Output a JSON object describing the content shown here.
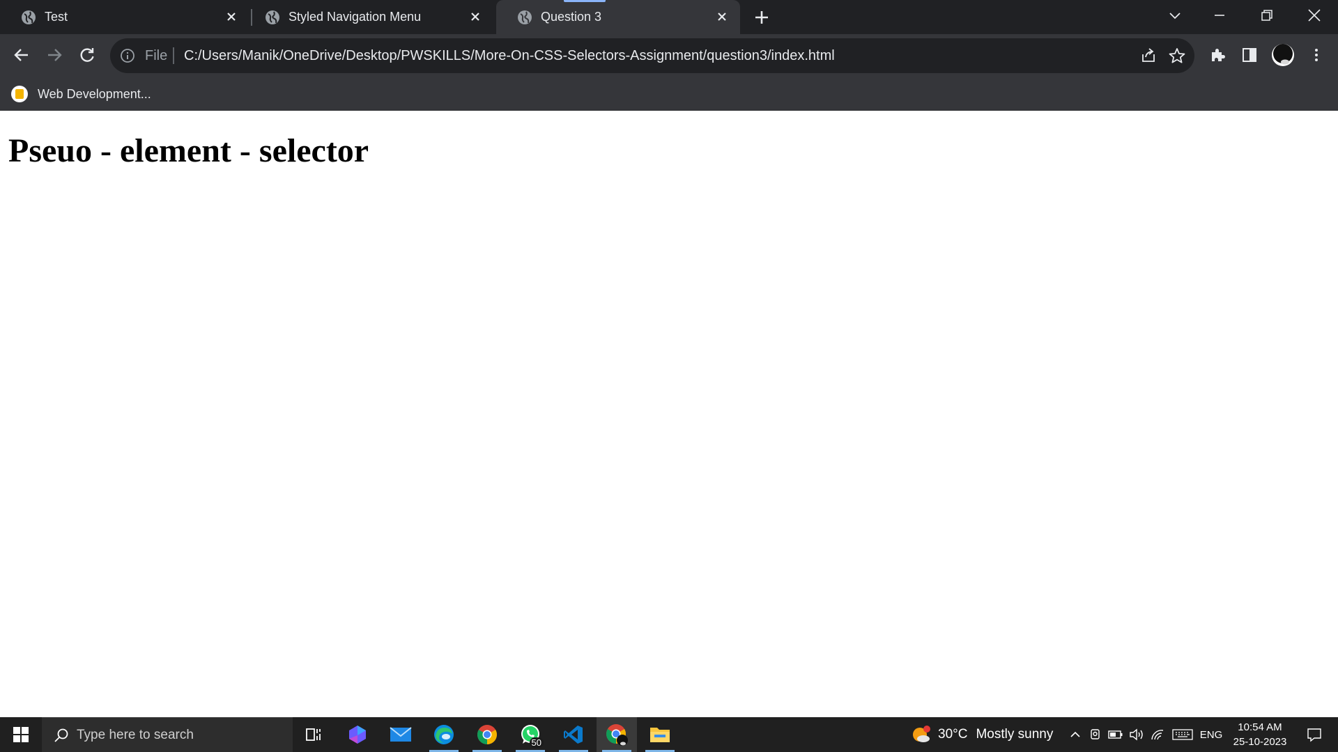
{
  "tabs": [
    {
      "title": "Test",
      "active": false,
      "icon": "globe-icon"
    },
    {
      "title": "Styled Navigation Menu",
      "active": false,
      "icon": "globe-icon"
    },
    {
      "title": "Question 3",
      "active": true,
      "icon": "globe-icon"
    }
  ],
  "omnibox": {
    "scheme_label": "File",
    "url": "C:/Users/Manik/OneDrive/Desktop/PWSKILLS/More-On-CSS-Selectors-Assignment/question3/index.html"
  },
  "bookmarks": [
    {
      "label": "Web Development..."
    }
  ],
  "page": {
    "heading": "Pseuo - element - selector"
  },
  "taskbar": {
    "search_placeholder": "Type here to search",
    "apps": [
      {
        "name": "task-view",
        "running": false
      },
      {
        "name": "copilot",
        "running": false
      },
      {
        "name": "mail",
        "running": false
      },
      {
        "name": "edge",
        "running": true
      },
      {
        "name": "chrome",
        "running": true
      },
      {
        "name": "whatsapp",
        "running": true,
        "badge": "50"
      },
      {
        "name": "vscode",
        "running": true
      },
      {
        "name": "chrome-profile",
        "running": true,
        "active": true
      },
      {
        "name": "file-explorer",
        "running": true
      }
    ],
    "weather": {
      "temp": "30°C",
      "condition": "Mostly sunny",
      "alert": "1"
    },
    "language": "ENG",
    "time": "10:54 AM",
    "date": "25-10-2023"
  },
  "colors": {
    "tabstrip_bg": "#202124",
    "toolbar_bg": "#35363a",
    "omnibox_bg": "#202124",
    "taskbar_bg": "#202020",
    "accent": "#8ab4f8"
  }
}
